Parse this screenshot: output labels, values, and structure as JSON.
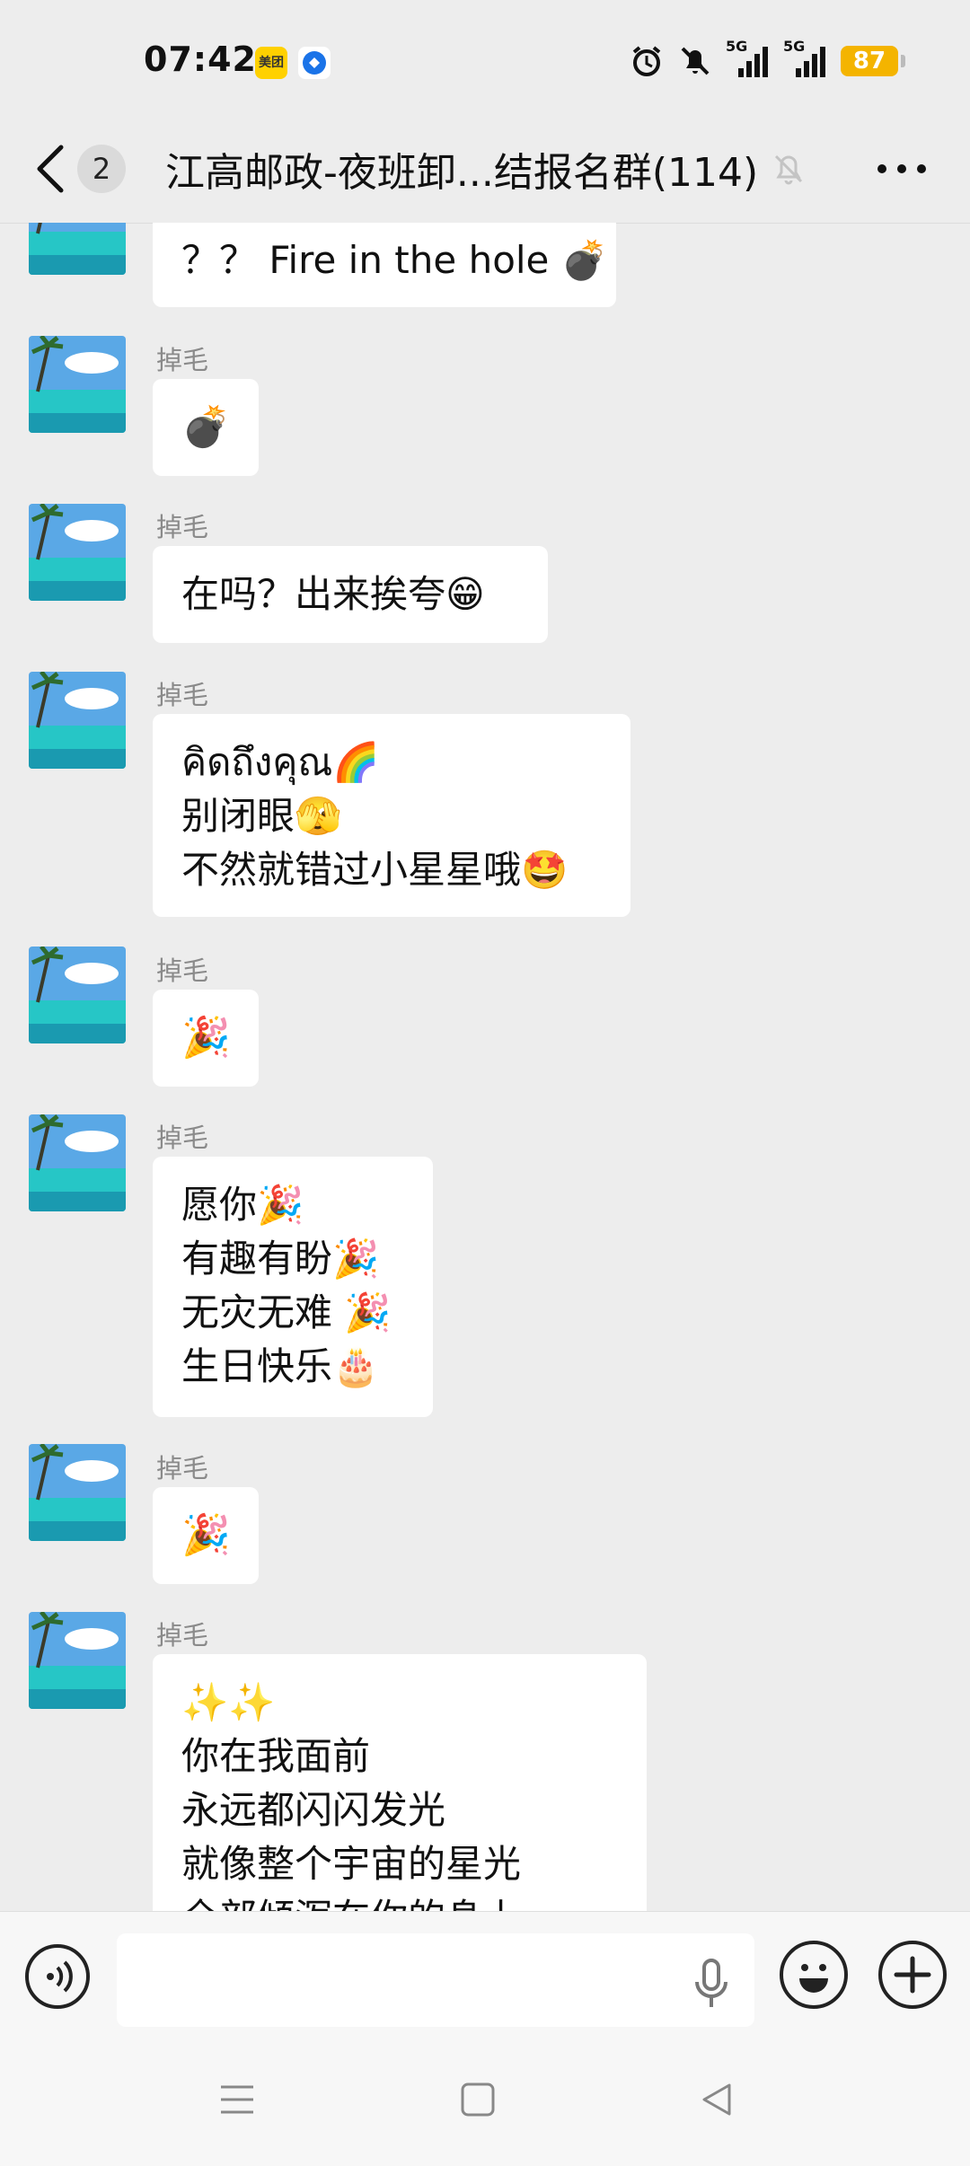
{
  "status_bar": {
    "time": "07:42",
    "app_badges": [
      "美团",
      "pay-app"
    ],
    "network_1": "5G",
    "network_2": "5G",
    "battery": "87"
  },
  "header": {
    "unread_count": "2",
    "title": "江高邮政-夜班卸...结报名群(114)"
  },
  "messages": [
    {
      "sender": "",
      "lines": [
        "？？ Fire in the hole 💣"
      ]
    },
    {
      "sender": "掉毛",
      "lines": [
        "💣"
      ]
    },
    {
      "sender": "掉毛",
      "lines": [
        "在吗？出来挨夸😁"
      ]
    },
    {
      "sender": "掉毛",
      "lines": [
        "คิดถึงคุณ🌈",
        "别闭眼🫣",
        "不然就错过小星星哦🤩"
      ]
    },
    {
      "sender": "掉毛",
      "lines": [
        "🎉"
      ]
    },
    {
      "sender": "掉毛",
      "lines": [
        "愿你🎉",
        "有趣有盼🎉",
        "无灾无难 🎉",
        "生日快乐🎂"
      ]
    },
    {
      "sender": "掉毛",
      "lines": [
        "🎉"
      ]
    },
    {
      "sender": "掉毛",
      "lines": [
        "✨✨",
        "你在我面前",
        "永远都闪闪发光",
        "就像整个宇宙的星光",
        "全部倾泻在你的身上"
      ]
    }
  ],
  "colors": {
    "background": "#ededed",
    "bubble": "#ffffff",
    "battery": "#f4b400",
    "sender": "#8a8a8a"
  }
}
